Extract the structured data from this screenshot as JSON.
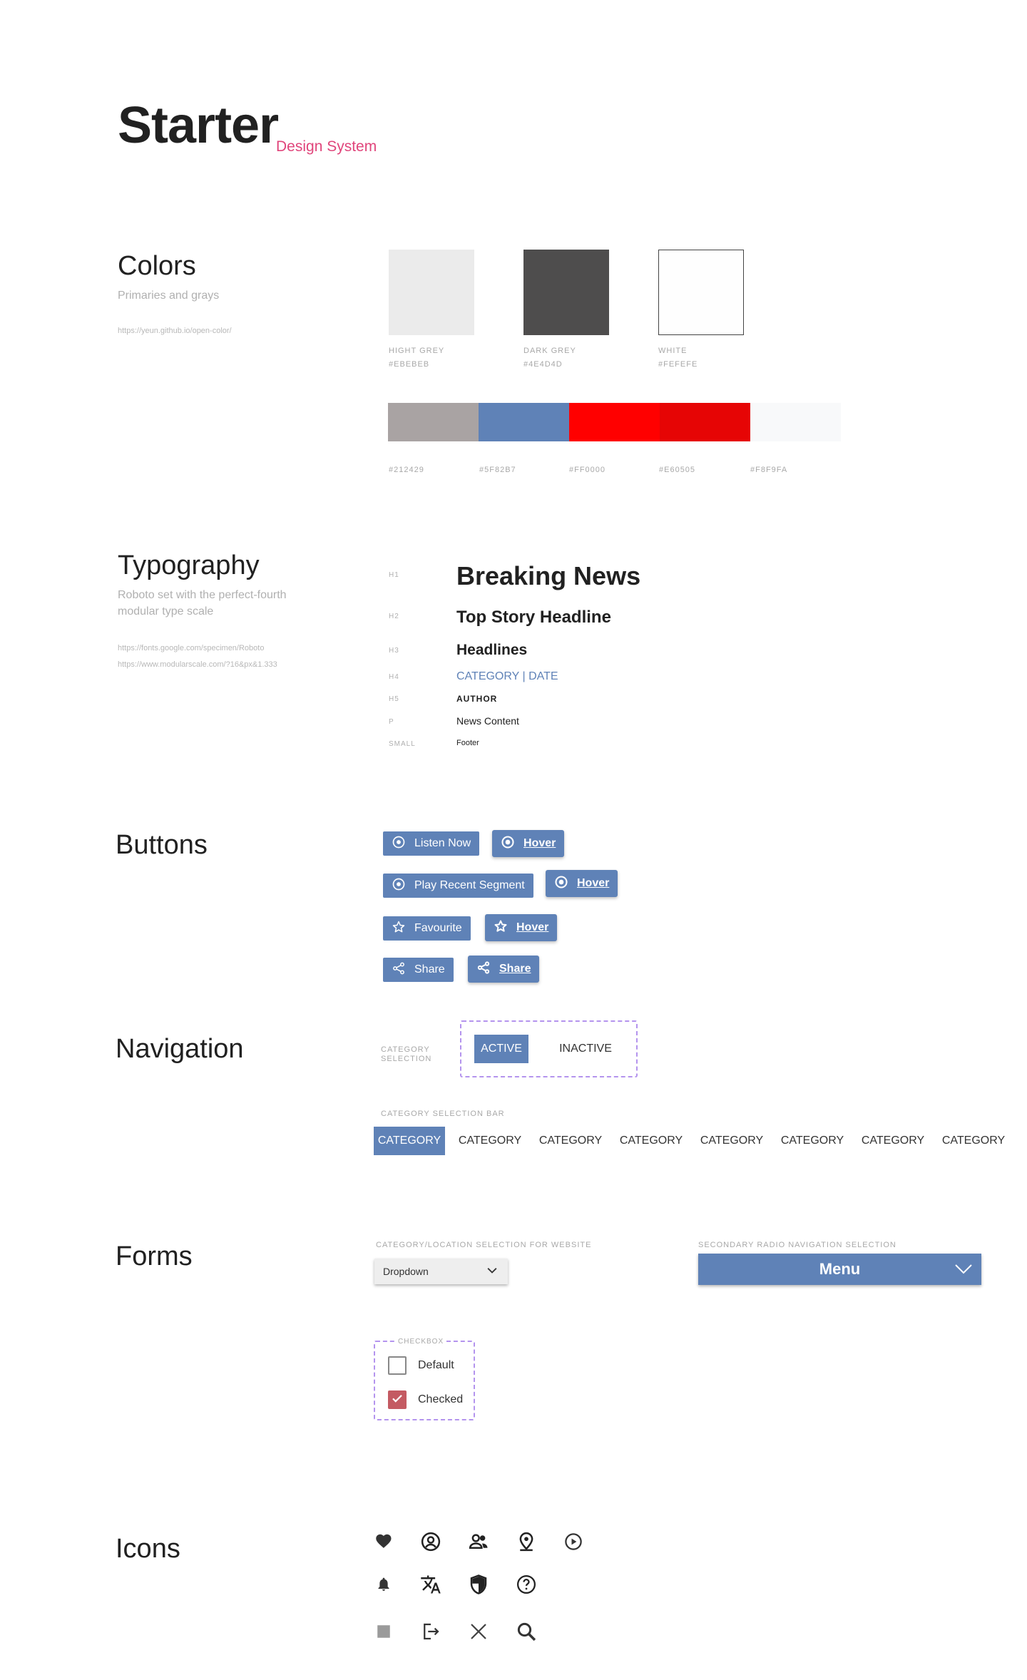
{
  "header": {
    "title": "Starter",
    "subtitle": "Design System"
  },
  "colors": {
    "title": "Colors",
    "subtitle": "Primaries and grays",
    "link": "https://yeun.github.io/open-color/",
    "swatches": [
      {
        "name": "HIGHT GREY",
        "hex": "#EBEBEB",
        "color": "#ebebeb"
      },
      {
        "name": "DARK GREY",
        "hex": "#4E4D4D",
        "color": "#4e4d4d"
      },
      {
        "name": "WHITE",
        "hex": "#FEFEFE",
        "color": "#fefefe"
      }
    ],
    "bar": [
      {
        "hex": "#212429",
        "color": "#a9a3a3"
      },
      {
        "hex": "#5F82B7",
        "color": "#5f82b7"
      },
      {
        "hex": "#FF0000",
        "color": "#ff0000"
      },
      {
        "hex": "#E60505",
        "color": "#e60505"
      },
      {
        "hex": "#F8F9FA",
        "color": "#f8f9fa"
      }
    ]
  },
  "typography": {
    "title": "Typography",
    "subtitle_line1": "Roboto set with the perfect-fourth",
    "subtitle_line2": "modular type scale",
    "link1": "https://fonts.google.com/specimen/Roboto",
    "link2": "https://www.modularscale.com/?16&px&1.333",
    "samples": [
      {
        "tag": "H1",
        "text": "Breaking News"
      },
      {
        "tag": "H2",
        "text": "Top Story Headline"
      },
      {
        "tag": "H3",
        "text": "Headlines"
      },
      {
        "tag": "H4",
        "text": "CATEGORY | DATE"
      },
      {
        "tag": "H5",
        "text": "AUTHOR"
      },
      {
        "tag": "P",
        "text": "News Content"
      },
      {
        "tag": "SMALL",
        "text": "Footer"
      }
    ]
  },
  "buttons": {
    "title": "Buttons",
    "listen_now": "Listen Now",
    "hover": "Hover",
    "play_recent": "Play Recent Segment",
    "favourite": "Favourite",
    "share": "Share"
  },
  "navigation": {
    "title": "Navigation",
    "category_selection_line1": "CATEGORY",
    "category_selection_line2": "SELECTION",
    "active": "ACTIVE",
    "inactive": "INACTIVE",
    "bar_label": "CATEGORY SELECTION BAR",
    "categories": [
      "CATEGORY",
      "CATEGORY",
      "CATEGORY",
      "CATEGORY",
      "CATEGORY",
      "CATEGORY",
      "CATEGORY",
      "CATEGORY"
    ]
  },
  "forms": {
    "title": "Forms",
    "dropdown_label": "CATEGORY/LOCATION SELECTION FOR WEBSITE",
    "dropdown_value": "Dropdown",
    "menu_label": "SECONDARY RADIO NAVIGATION SELECTION",
    "menu_value": "Menu",
    "checkbox_label": "CHECKBOX",
    "cb_default": "Default",
    "cb_checked": "Checked"
  },
  "icons": {
    "title": "Icons",
    "names": [
      "heart-icon",
      "account-circle-icon",
      "people-icon",
      "location-icon",
      "play-circle-icon",
      "bell-icon",
      "translate-icon",
      "shield-icon",
      "help-circle-icon",
      "stop-icon",
      "logout-icon",
      "close-icon",
      "search-icon"
    ]
  },
  "accent": {
    "brand_blue": "#5f82b7",
    "pink": "#e0457b",
    "dashed_purple": "#b494ee",
    "checkbox_red": "#c45a62"
  }
}
